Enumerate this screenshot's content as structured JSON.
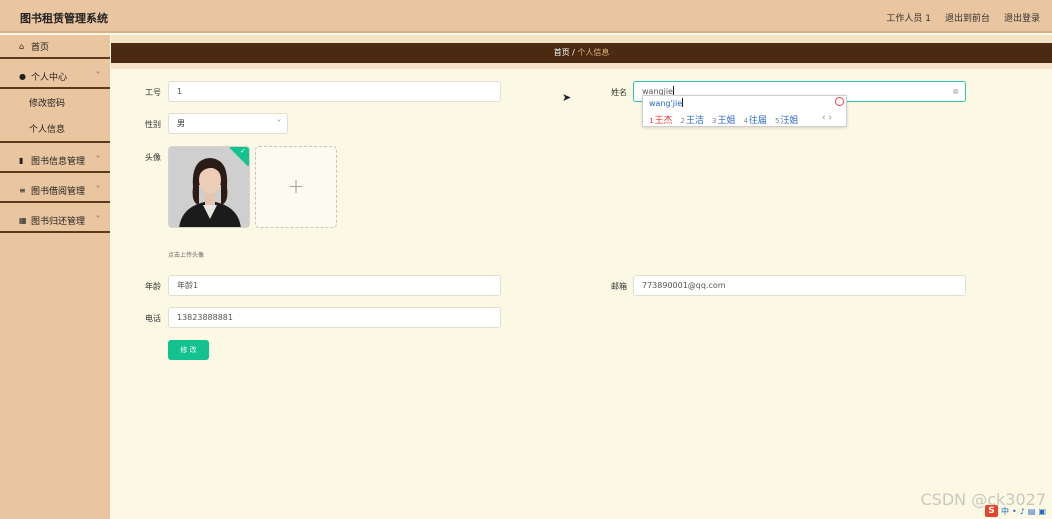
{
  "app": {
    "title": "图书租赁管理系统",
    "top_links": [
      "工作人员 1",
      "退出到前台",
      "退出登录"
    ]
  },
  "sidebar": {
    "home": {
      "label": "首页",
      "icon": "home-icon"
    },
    "personal": {
      "label": "个人中心",
      "icon": "user-icon"
    },
    "sub_items": [
      "修改密码",
      "个人信息"
    ],
    "book_info": {
      "label": "图书信息管理",
      "icon": "bar-chart-icon"
    },
    "borrow": {
      "label": "图书借阅管理",
      "icon": "list-icon"
    },
    "return": {
      "label": "图书归还管理",
      "icon": "grid-icon"
    }
  },
  "breadcrumb": {
    "home": "首页",
    "separator": "/",
    "current": "个人信息"
  },
  "form": {
    "id_label": "工号",
    "id_value": "1",
    "name_label": "姓名",
    "name_value": "wangjie",
    "gender_label": "性别",
    "gender_value": "男",
    "avatar_label": "头像",
    "avatar_hint": "点击上传头像",
    "age_label": "年龄",
    "age_value": "年龄1",
    "email_label": "邮箱",
    "email_value": "773890001@qq.com",
    "phone_label": "电话",
    "phone_value": "13823888881",
    "submit_label": "修 改"
  },
  "ime": {
    "composition": "wang'jie",
    "candidates": [
      {
        "n": "1",
        "text": "王杰"
      },
      {
        "n": "2",
        "text": "王洁"
      },
      {
        "n": "3",
        "text": "王姐"
      },
      {
        "n": "4",
        "text": "往届"
      },
      {
        "n": "5",
        "text": "汪姐"
      }
    ],
    "arrows": "‹ ›"
  },
  "watermark": "CSDN @ck3027",
  "colors": {
    "accent": "#13c28f",
    "sidebar": "#eac6a0",
    "breadcrumb_bg": "#4a2a10",
    "page_bg": "#fbf8e4"
  }
}
